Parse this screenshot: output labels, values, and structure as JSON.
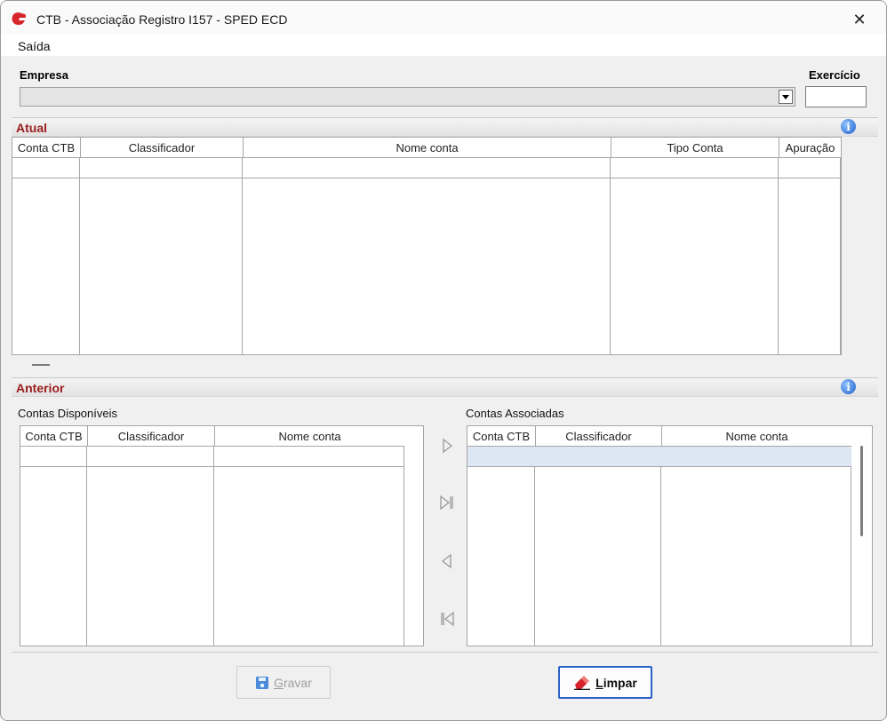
{
  "window": {
    "title": "CTB - Associação Registro I157 - SPED ECD",
    "close_glyph": "✕"
  },
  "menu": {
    "items": [
      {
        "label": "Saída"
      }
    ]
  },
  "form": {
    "empresa_label": "Empresa",
    "exercicio_label": "Exercício",
    "empresa_value": "",
    "exercicio_value": ""
  },
  "atual": {
    "title": "Atual",
    "columns": [
      "Conta CTB",
      "Classificador",
      "Nome conta",
      "Tipo Conta",
      "Apuração"
    ]
  },
  "anterior": {
    "title": "Anterior",
    "disponiveis": {
      "label": "Contas Disponíveis",
      "columns": [
        "Conta CTB",
        "Classificador",
        "Nome conta"
      ]
    },
    "associadas": {
      "label": "Contas Associadas",
      "columns": [
        "Conta CTB",
        "Classificador",
        "Nome conta"
      ]
    }
  },
  "buttons": {
    "gravar": "Gravar",
    "limpar": "Limpar"
  },
  "icons": {
    "app": "app-logo-icon",
    "info": "info-icon",
    "move_right": "move-right-icon",
    "move_all_right": "move-all-right-icon",
    "move_left": "move-left-icon",
    "move_all_left": "move-all-left-icon",
    "save": "floppy-disk-icon",
    "clear": "eraser-icon"
  },
  "colors": {
    "section_title": "#9b1b1b",
    "primary_border": "#2a62c9",
    "selected_row": "#dce7f3"
  }
}
